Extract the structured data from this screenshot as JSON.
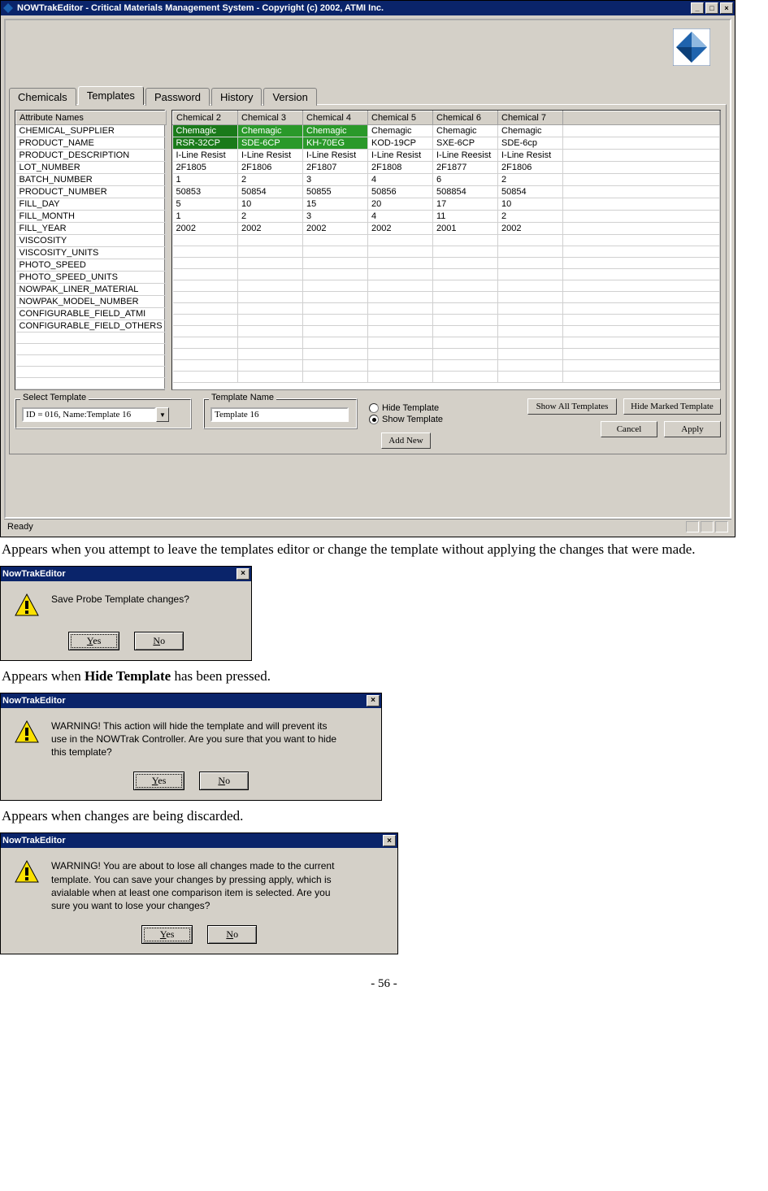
{
  "main_window": {
    "title": "NOWTrakEditor - Critical Materials Management System - Copyright (c) 2002, ATMI Inc.",
    "tabs": [
      "Chemicals",
      "Templates",
      "Password",
      "History",
      "Version"
    ],
    "active_tab": 1,
    "attr_header": "Attribute Names",
    "attribute_names": [
      "CHEMICAL_SUPPLIER",
      "PRODUCT_NAME",
      "PRODUCT_DESCRIPTION",
      "LOT_NUMBER",
      "BATCH_NUMBER",
      "PRODUCT_NUMBER",
      "FILL_DAY",
      "FILL_MONTH",
      "FILL_YEAR",
      "VISCOSITY",
      "VISCOSITY_UNITS",
      "PHOTO_SPEED",
      "PHOTO_SPEED_UNITS",
      "NOWPAK_LINER_MATERIAL",
      "NOWPAK_MODEL_NUMBER",
      "CONFIGURABLE_FIELD_ATMI",
      "CONFIGURABLE_FIELD_OTHERS"
    ],
    "data_headers": [
      "Chemical 2",
      "Chemical 3",
      "Chemical 4",
      "Chemical 5",
      "Chemical 6",
      "Chemical 7"
    ],
    "data_rows": [
      {
        "cells": [
          "Chemagic",
          "Chemagic",
          "Chemagic",
          "Chemagic",
          "Chemagic",
          "Chemagic"
        ],
        "hl": [
          true,
          true,
          true,
          false,
          false,
          false
        ]
      },
      {
        "cells": [
          "RSR-32CP",
          "SDE-6CP",
          "KH-70EG",
          "KOD-19CP",
          "SXE-6CP",
          "SDE-6cp"
        ],
        "hl": [
          true,
          true,
          true,
          false,
          false,
          false
        ]
      },
      {
        "cells": [
          "I-Line Resist",
          "I-Line Resist",
          "I-Line Resist",
          "I-Line Resist",
          "I-Line Reesist",
          "I-Line Resist"
        ],
        "hl": [
          false,
          false,
          false,
          false,
          false,
          false
        ]
      },
      {
        "cells": [
          "2F1805",
          "2F1806",
          "2F1807",
          "2F1808",
          "2F1877",
          "2F1806"
        ],
        "hl": [
          false,
          false,
          false,
          false,
          false,
          false
        ]
      },
      {
        "cells": [
          "1",
          "2",
          "3",
          "4",
          "6",
          "2"
        ],
        "hl": [
          false,
          false,
          false,
          false,
          false,
          false
        ]
      },
      {
        "cells": [
          "50853",
          "50854",
          "50855",
          "50856",
          "508854",
          "50854"
        ],
        "hl": [
          false,
          false,
          false,
          false,
          false,
          false
        ]
      },
      {
        "cells": [
          "5",
          "10",
          "15",
          "20",
          "17",
          "10"
        ],
        "hl": [
          false,
          false,
          false,
          false,
          false,
          false
        ]
      },
      {
        "cells": [
          "1",
          "2",
          "3",
          "4",
          "11",
          "2"
        ],
        "hl": [
          false,
          false,
          false,
          false,
          false,
          false
        ]
      },
      {
        "cells": [
          "2002",
          "2002",
          "2002",
          "2002",
          "2001",
          "2002"
        ],
        "hl": [
          false,
          false,
          false,
          false,
          false,
          false
        ]
      },
      {
        "cells": [
          "",
          "",
          "",
          "",
          "",
          ""
        ]
      },
      {
        "cells": [
          "",
          "",
          "",
          "",
          "",
          ""
        ]
      },
      {
        "cells": [
          "",
          "",
          "",
          "",
          "",
          ""
        ]
      },
      {
        "cells": [
          "",
          "",
          "",
          "",
          "",
          ""
        ]
      },
      {
        "cells": [
          "",
          "",
          "",
          "",
          "",
          ""
        ]
      },
      {
        "cells": [
          "",
          "",
          "",
          "",
          "",
          ""
        ]
      },
      {
        "cells": [
          "",
          "",
          "",
          "",
          "",
          ""
        ]
      },
      {
        "cells": [
          "",
          "",
          "",
          "",
          "",
          ""
        ]
      }
    ],
    "select_template_label": "Select Template",
    "select_template_value": "ID = 016, Name:Template 16",
    "template_name_label": "Template Name",
    "template_name_value": "Template 16",
    "hide_template_label": "Hide Template",
    "show_template_label": "Show Template",
    "show_template_selected": true,
    "btn_add_new": "Add New",
    "btn_show_all": "Show All Templates",
    "btn_hide_marked": "Hide Marked Template",
    "btn_cancel": "Cancel",
    "btn_apply": "Apply",
    "status": "Ready"
  },
  "caption1": "Appears when you attempt to leave the templates editor or change the template without applying the changes that were made.",
  "caption2_pre": "Appears when ",
  "caption2_bold": "Hide Template",
  "caption2_post": " has been pressed.",
  "caption3": "Appears when changes are being discarded.",
  "dialogs": {
    "d1": {
      "title": "NowTrakEditor",
      "message": "Save Probe Template changes?",
      "yes": "Yes",
      "no": "No"
    },
    "d2": {
      "title": "NowTrakEditor",
      "message": "WARNING! This action will hide the template and will prevent its use in the NOWTrak Controller. Are you sure that you want to hide this template?",
      "yes": "Yes",
      "no": "No"
    },
    "d3": {
      "title": "NowTrakEditor",
      "message": "WARNING! You are about to lose all changes made to the current template.  You can save your changes by pressing apply, which is avialable when at least one comparison item is selected. Are you sure you want to lose your changes?",
      "yes": "Yes",
      "no": "No"
    }
  },
  "page_number": "- 56 -"
}
